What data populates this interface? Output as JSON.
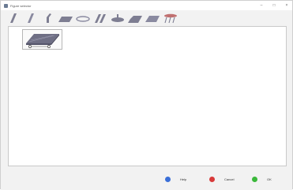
{
  "window": {
    "title": "Figure selector",
    "controls": {
      "minimize": "–",
      "maximize": "□",
      "close": "×"
    }
  },
  "toolbar": {
    "shapes": [
      "slanted-bar-icon",
      "slanted-bar-icon-2",
      "hook-bar-icon",
      "flat-plate-icon",
      "ellipse-icon",
      "double-slant-icon",
      "disc-icon",
      "cut-plate-icon",
      "wedge-plate-icon",
      "spring-figure-icon"
    ]
  },
  "footer": {
    "help": "Help",
    "cancel": "Cancel",
    "ok": "OK"
  },
  "colors": {
    "help": "#3a6fd8",
    "cancel": "#d83a3a",
    "ok": "#3ab83a",
    "shape_fill": "#7e7e92"
  }
}
